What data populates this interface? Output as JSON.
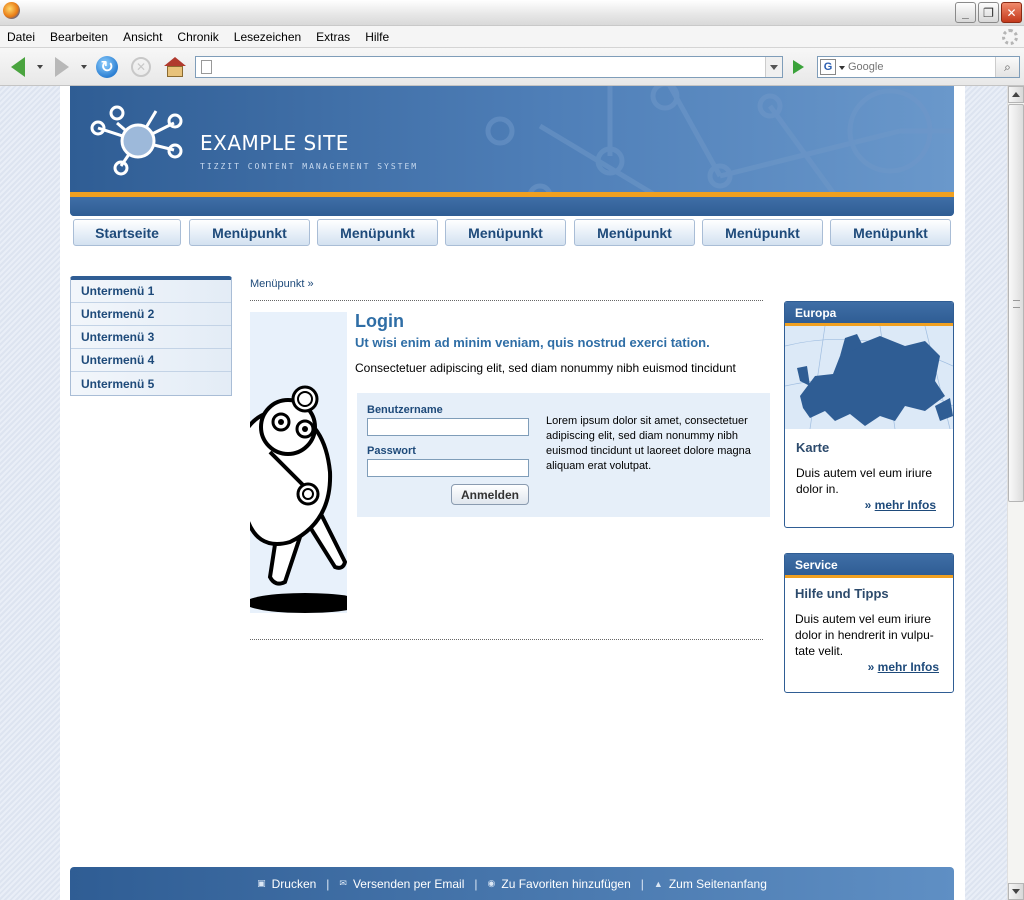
{
  "browser": {
    "menu": [
      "Datei",
      "Bearbeiten",
      "Ansicht",
      "Chronik",
      "Lesezeichen",
      "Extras",
      "Hilfe"
    ],
    "url": "",
    "search_placeholder": "Google"
  },
  "site": {
    "title": "EXAMPLE SITE",
    "subtitle": "TIZZIT CONTENT MANAGEMENT SYSTEM",
    "nav": [
      "Startseite",
      "Menüpunkt",
      "Menüpunkt",
      "Menüpunkt",
      "Menüpunkt",
      "Menüpunkt",
      "Menüpunkt"
    ],
    "submenu": [
      "Untermenü 1",
      "Untermenü 2",
      "Untermenü 3",
      "Untermenü 4",
      "Untermenü 5"
    ],
    "breadcrumb": "Menüpunkt »"
  },
  "login": {
    "title": "Login",
    "subtitle": "Ut wisi enim ad minim veniam, quis nostrud exerci tation.",
    "intro": "Consectetuer adipiscing elit, sed diam nonummy nibh euismod tincidunt",
    "username_label": "Benutzername",
    "password_label": "Passwort",
    "submit_label": "Anmelden",
    "info_text": "Lorem ipsum dolor sit amet, consectetuer adipiscing elit, sed diam nonummy nibh euismod tincidunt ut laoreet dolore magna aliquam erat volutpat."
  },
  "sidebar": {
    "europa": {
      "header": "Europa",
      "title": "Karte",
      "text": "Duis autem vel eum iriure dolor in.",
      "more_prefix": "»",
      "more": "mehr Infos"
    },
    "service": {
      "header": "Service",
      "title": "Hilfe und Tipps",
      "text": "Duis autem vel eum iriure dolor in hendrerit in vulpu-tate velit.",
      "more_prefix": "»",
      "more": "mehr Infos"
    }
  },
  "footer": {
    "print": "Drucken",
    "email": "Versenden per Email",
    "favorites": "Zu Favoriten hinzufügen",
    "top": "Zum Seitenanfang",
    "separator": "|"
  },
  "colors": {
    "brand_blue": "#2f5d94",
    "accent_orange": "#f0a020",
    "link_blue": "#1e4a7a"
  }
}
